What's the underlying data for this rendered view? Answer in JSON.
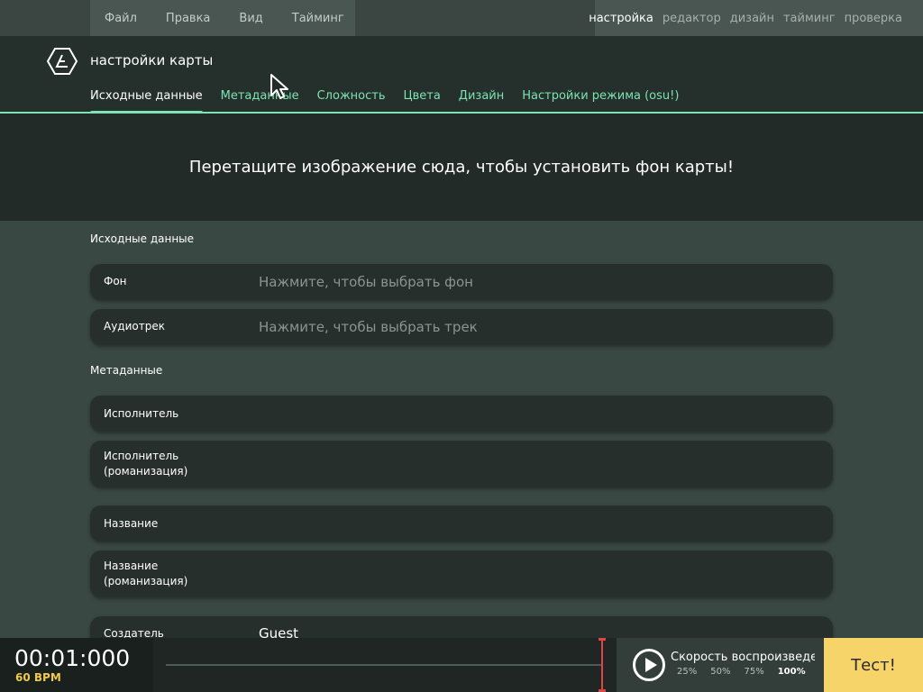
{
  "menu": {
    "left": [
      "Файл",
      "Правка",
      "Вид",
      "Тайминг"
    ],
    "right": [
      "настройка",
      "редактор",
      "дизайн",
      "тайминг",
      "проверка"
    ],
    "active_right": "настройка"
  },
  "header": {
    "title": "настройки карты",
    "tabs": [
      "Исходные данные",
      "Метаданные",
      "Сложность",
      "Цвета",
      "Дизайн",
      "Настройки режима (osu!)"
    ],
    "active_tab": "Исходные данные"
  },
  "dropzone": {
    "text": "Перетащите изображение сюда, чтобы установить фон карты!"
  },
  "sections": {
    "source": {
      "title": "Исходные данные",
      "background_label": "Фон",
      "background_placeholder": "Нажмите, чтобы выбрать фон",
      "audio_label": "Аудиотрек",
      "audio_placeholder": "Нажмите, чтобы выбрать трек"
    },
    "metadata": {
      "title": "Метаданные",
      "artist_label": "Исполнитель",
      "artist_roman_label_1": "Исполнитель",
      "artist_roman_label_2": "(романизация)",
      "title_label": "Название",
      "title_roman_label_1": "Название",
      "title_roman_label_2": "(романизация)",
      "creator_label": "Создатель",
      "creator_value": "Guest"
    }
  },
  "bottom": {
    "time": "00:01:000",
    "bpm": "60 BPM",
    "playback_title": "Скорость воспроизведения",
    "speeds": [
      "25%",
      "50%",
      "75%",
      "100%"
    ],
    "active_speed": "100%",
    "test_label": "Тест!"
  },
  "colors": {
    "accent": "#7de3b2",
    "test_button": "#f7d46a",
    "bpm": "#f2c94c",
    "marker": "#e04545"
  }
}
